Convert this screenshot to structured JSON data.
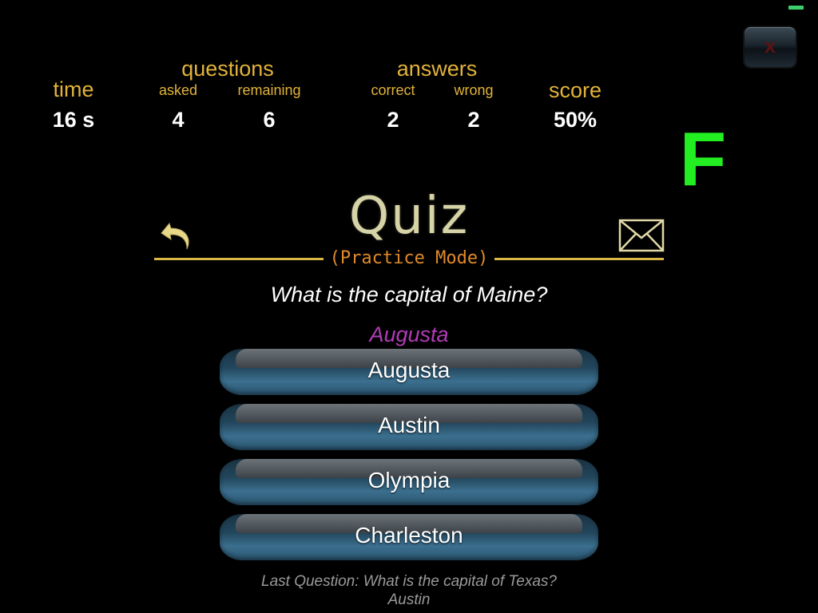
{
  "stats": {
    "time": {
      "label": "time",
      "value": "16 s"
    },
    "questions": {
      "label": "questions",
      "asked": {
        "label": "asked",
        "value": "4"
      },
      "remaining": {
        "label": "remaining",
        "value": "6"
      }
    },
    "answers": {
      "label": "answers",
      "correct": {
        "label": "correct",
        "value": "2"
      },
      "wrong": {
        "label": "wrong",
        "value": "2"
      }
    },
    "score": {
      "label": "score",
      "value": "50%"
    }
  },
  "grade": "F",
  "header": {
    "title": "Quiz",
    "mode": "(Practice Mode)",
    "close_label": "x"
  },
  "question": {
    "text": "What is the capital of Maine?",
    "correct_hint": "Augusta",
    "options": [
      "Augusta",
      "Austin",
      "Olympia",
      "Charleston"
    ]
  },
  "last": {
    "question": "Last Question: What is the capital of Texas?",
    "answer": "Austin"
  },
  "icons": {
    "back": "back-arrow-icon",
    "mail": "envelope-icon",
    "close": "close-icon"
  },
  "colors": {
    "stat_label": "#e2b33a",
    "grade": "#22ee22",
    "mode_label": "#e08a2a",
    "hint": "#b23bb8",
    "rule": "#d8b744"
  }
}
